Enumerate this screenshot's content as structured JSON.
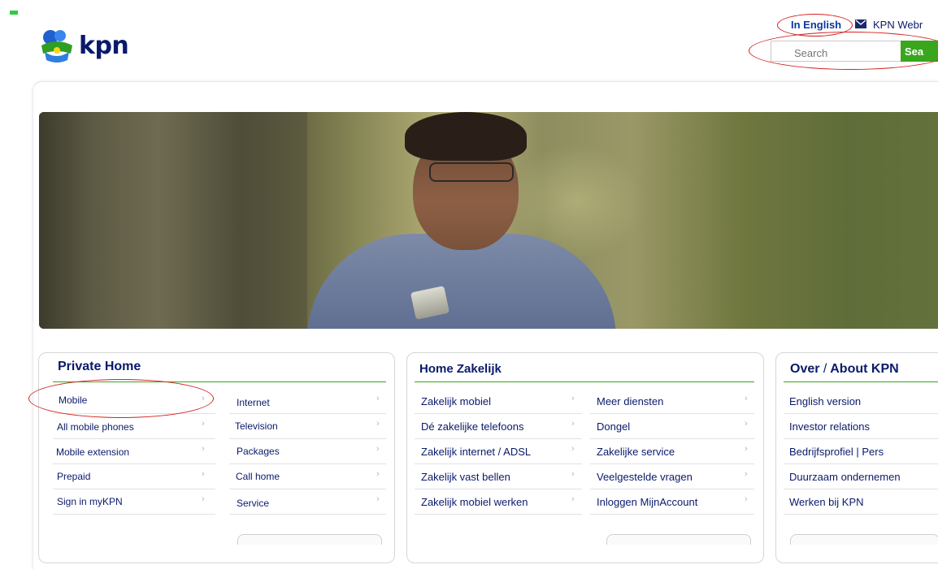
{
  "header": {
    "logo_text": "kpn",
    "language_link": "In English",
    "webmail_link": "KPN Webr",
    "search": {
      "placeholder": "Search",
      "button_label": "Sea"
    }
  },
  "panels": {
    "private": {
      "title": "Private Home",
      "col1": [
        "Mobile",
        "All mobile phones",
        "Mobile extension",
        "Prepaid",
        "Sign in myKPN"
      ],
      "col2": [
        "Internet",
        "Television",
        "Packages",
        "Call home",
        "Service"
      ]
    },
    "zakelijk": {
      "title": "Home Zakelijk",
      "col1": [
        "Zakelijk mobiel",
        "Dé zakelijke telefoons",
        "Zakelijk internet / ADSL",
        "Zakelijk vast bellen",
        "Zakelijk mobiel werken"
      ],
      "col2": [
        "Meer diensten",
        "Dongel",
        "Zakelijke service",
        "Veelgestelde vragen",
        "Inloggen MijnAccount"
      ]
    },
    "about": {
      "title_part1": "Over",
      "title_sep": "/",
      "title_part2": "About KPN",
      "links": [
        "English version",
        "Investor relations",
        "Bedrijfsprofiel | Pers",
        "Duurzaam ondernemen",
        "Werken bij KPN"
      ]
    }
  },
  "chevron": "›",
  "colors": {
    "brand_navy": "#0a1a6a",
    "accent_green": "#3aa61e",
    "annotation_red": "#d42020"
  },
  "icons": [
    "kpn-crown-logo-icon",
    "mail-icon",
    "chevron-right-icon"
  ]
}
